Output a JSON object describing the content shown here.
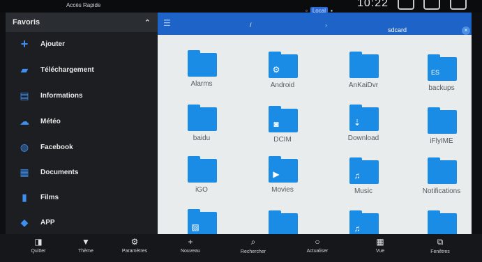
{
  "header": {
    "quick_access": "Accès Rapide",
    "storage_label": "Local",
    "time": "10:22"
  },
  "sidebar": {
    "title": "Favoris",
    "items": [
      {
        "label": "Ajouter",
        "icon": "plus-icon"
      },
      {
        "label": "Téléchargement",
        "icon": "download-folder-icon"
      },
      {
        "label": "Informations",
        "icon": "document-icon"
      },
      {
        "label": "Météo",
        "icon": "weather-icon"
      },
      {
        "label": "Facebook",
        "icon": "globe-icon"
      },
      {
        "label": "Documents",
        "icon": "documents-icon"
      },
      {
        "label": "Films",
        "icon": "film-icon"
      },
      {
        "label": "APP",
        "icon": "app-icon"
      }
    ]
  },
  "pathbar": {
    "root": "/",
    "current": "sdcard"
  },
  "folders": [
    {
      "name": "Alarms"
    },
    {
      "name": "Android"
    },
    {
      "name": "AnKaiDvr"
    },
    {
      "name": "backups"
    },
    {
      "name": "baidu"
    },
    {
      "name": "DCIM"
    },
    {
      "name": "Download"
    },
    {
      "name": "iFlyIME"
    },
    {
      "name": "iGO"
    },
    {
      "name": "Movies"
    },
    {
      "name": "Music"
    },
    {
      "name": "Notifications"
    },
    {
      "name": ""
    },
    {
      "name": ""
    },
    {
      "name": ""
    },
    {
      "name": ""
    }
  ],
  "bottombar": {
    "quit": "Quitter",
    "theme": "Thème",
    "settings": "Paramètres",
    "new": "Nouveau",
    "search": "Rechercher",
    "refresh": "Actualiser",
    "view": "Vue",
    "windows": "Fenêtres"
  },
  "colors": {
    "accent": "#1e63c8",
    "folder": "#1b8ce6",
    "sidebar_bg": "#1c1e21"
  }
}
